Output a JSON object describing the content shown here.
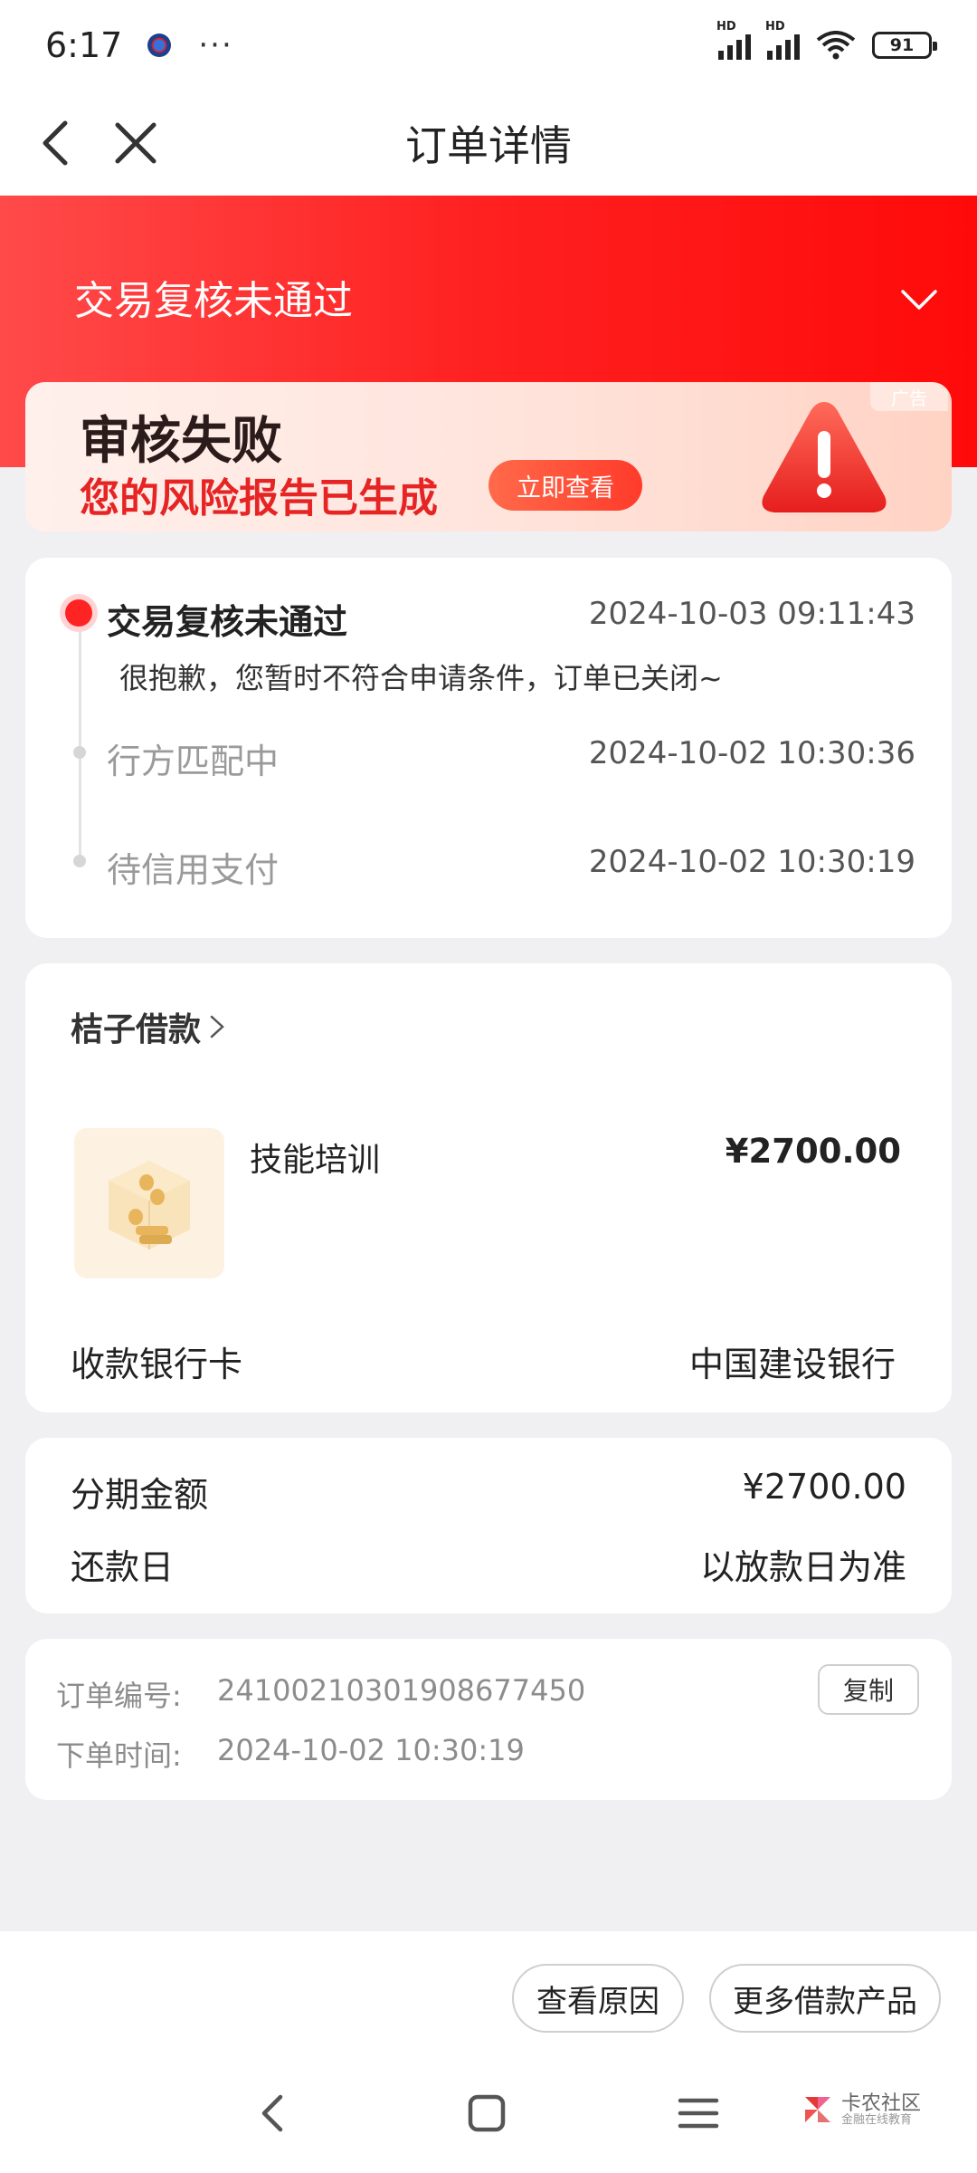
{
  "status_bar": {
    "time": "6:17",
    "more": "···",
    "signal_label": "HD",
    "battery": "91"
  },
  "nav": {
    "title": "订单详情"
  },
  "banner": {
    "status_title": "交易复核未通过"
  },
  "ad": {
    "headline": "审核失败",
    "subline": "您的风险报告已生成",
    "button": "立即查看",
    "tag": "广告"
  },
  "timeline": {
    "items": [
      {
        "label": "交易复核未通过",
        "time": "2024-10-03 09:11:43",
        "desc": "很抱歉，您暂时不符合申请条件，订单已关闭~"
      },
      {
        "label": "行方匹配中",
        "time": "2024-10-02 10:30:36"
      },
      {
        "label": "待信用支付",
        "time": "2024-10-02 10:30:19"
      }
    ]
  },
  "product": {
    "lender": "桔子借款",
    "name": "技能培训",
    "price": "¥2700.00",
    "bank_label": "收款银行卡",
    "bank_value": "中国建设银行"
  },
  "installment": {
    "amount_label": "分期金额",
    "amount_value": "¥2700.00",
    "repay_label": "还款日",
    "repay_value": "以放款日为准"
  },
  "order": {
    "number_label": "订单编号:",
    "number_value": "24100210301908677450",
    "copy_button": "复制",
    "time_label": "下单时间:",
    "time_value": "2024-10-02 10:30:19"
  },
  "actions": {
    "reason_button": "查看原因",
    "more_products_button": "更多借款产品"
  },
  "watermark": {
    "title": "卡农社区",
    "subtitle": "金融在线教育"
  },
  "colors": {
    "accent_red": "#ff2424",
    "background": "#f0f0f2"
  }
}
